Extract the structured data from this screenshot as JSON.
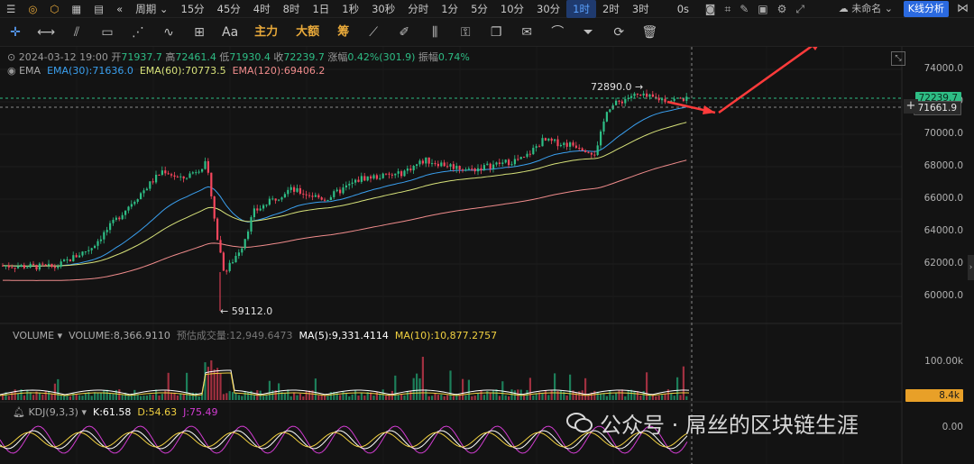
{
  "topbar": {
    "icons": [
      "menu-icon",
      "target-icon",
      "bolt-icon",
      "calendar-icon",
      "grid-icon",
      "rewind-icon"
    ],
    "period_label": "周期",
    "intervals": [
      "15分",
      "45分",
      "4时",
      "8时",
      "1日",
      "1秒",
      "30秒",
      "分时",
      "1分",
      "5分",
      "10分",
      "30分",
      "1时",
      "2时",
      "3时"
    ],
    "active_interval": "1时",
    "countdown": "0s",
    "layout_name": "未命名",
    "analysis_button": "K线分析"
  },
  "toolbar": {
    "text_tools": [
      "主力",
      "大额",
      "筹"
    ],
    "font_tool": "Aa"
  },
  "ohlc": {
    "date": "2024-03-12 19:00",
    "open_label": "开",
    "open": "71937.7",
    "high_label": "高",
    "high": "72461.4",
    "low_label": "低",
    "low": "71930.4",
    "close_label": "收",
    "close": "72239.7",
    "change_label": "涨幅",
    "change": "0.42%(301.9)",
    "amp_label": "振幅",
    "amp": "0.74%"
  },
  "ema": {
    "label": "EMA",
    "ema30": "EMA(30):71636.0",
    "ema60": "EMA(60):70773.5",
    "ema120": "EMA(120):69406.2"
  },
  "price_axis": [
    "74000.0",
    "72000.0",
    "70000.0",
    "68000.0",
    "66000.0",
    "64000.0",
    "62000.0",
    "60000.0"
  ],
  "price_tags": {
    "last": "72239.7",
    "crosshair": "71661.9"
  },
  "annotations": {
    "high": "72890.0 →",
    "low": "← 59112.0"
  },
  "volume": {
    "label": "VOLUME",
    "value": "VOLUME:8,366.9110",
    "forecast": "预估成交量:12,949.6473",
    "ma5": "MA(5):9,331.4114",
    "ma10": "MA(10):10,877.2757",
    "axis": "100.00k",
    "tag": "8.4k"
  },
  "kdj": {
    "label": "KDJ(9,3,3)",
    "k": "K:61.58",
    "d": "D:54.63",
    "j": "J:75.49",
    "axis": "0.00"
  },
  "watermark": "公众号 · 屌丝的区块链生涯",
  "colors": {
    "up": "#2ebd85",
    "down": "#f6465d",
    "ema30": "#3aa0f0",
    "ema60": "#d7e27a",
    "ema120": "#f08c8c",
    "ma5": "#ffffff",
    "ma10": "#f0d040",
    "k": "#ffffff",
    "d": "#f0d040",
    "j": "#d23cd2",
    "accent": "#2b6ae0",
    "arrow": "#ff3b3b"
  }
}
